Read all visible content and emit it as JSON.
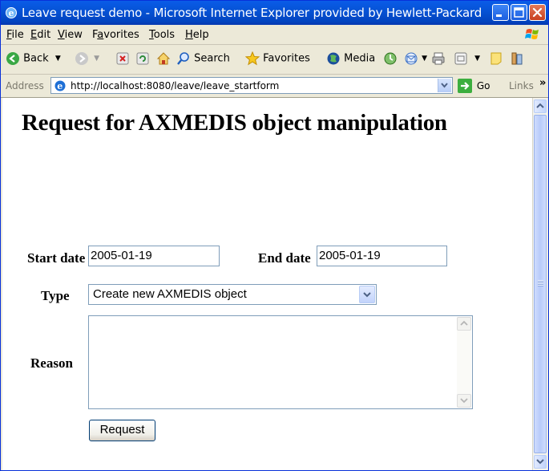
{
  "window": {
    "title": "Leave request demo - Microsoft Internet Explorer provided by Hewlett-Packard",
    "controls": {
      "minimize": "minimize-icon",
      "maximize": "maximize-icon",
      "close": "close-icon"
    }
  },
  "menubar": {
    "items": [
      {
        "label": "File",
        "mnemonic": "F",
        "rest": "ile"
      },
      {
        "label": "Edit",
        "mnemonic": "E",
        "rest": "dit"
      },
      {
        "label": "View",
        "mnemonic": "V",
        "rest": "iew"
      },
      {
        "label": "Favorites",
        "mnemonic": "a",
        "pre": "F",
        "rest": "vorites"
      },
      {
        "label": "Tools",
        "mnemonic": "T",
        "rest": "ools"
      },
      {
        "label": "Help",
        "mnemonic": "H",
        "rest": "elp"
      }
    ]
  },
  "toolbar": {
    "back": "Back",
    "search": "Search",
    "favorites": "Favorites",
    "media": "Media"
  },
  "addressbar": {
    "label": "Address",
    "url": "http://localhost:8080/leave/leave_startform",
    "go": "Go",
    "links": "Links",
    "chevron": "»"
  },
  "form": {
    "heading": "Request for AXMEDIS object manipulation",
    "start_date_label": "Start date",
    "start_date_value": "2005-01-19",
    "end_date_label": "End date",
    "end_date_value": "2005-01-19",
    "type_label": "Type",
    "type_selected": "Create new AXMEDIS object",
    "reason_label": "Reason",
    "reason_value": "",
    "submit_label": "Request"
  },
  "colors": {
    "titlebar": "#0653d6",
    "chrome": "#ece9d8",
    "field_border": "#7f9db9"
  }
}
